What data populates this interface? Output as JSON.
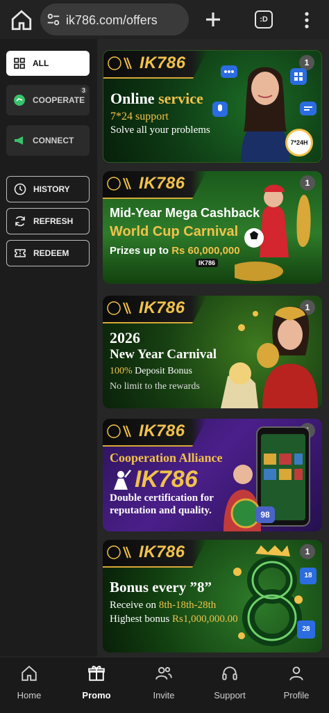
{
  "browser": {
    "url": "ik786.com/offers",
    "tabs_label": ":D"
  },
  "sidebar": {
    "all": "ALL",
    "cooperate": "COOPERATE",
    "cooperate_badge": "3",
    "connect": "CONNECT",
    "history": "HISTORY",
    "refresh": "REFRESH",
    "redeem": "REDEEM"
  },
  "brand": "IK786",
  "banners": [
    {
      "count": "1",
      "title_white": "Online ",
      "title_gold": "service",
      "line1": "7*24 support",
      "line2": "Solve all your problems",
      "badge": "7*24H"
    },
    {
      "count": "1",
      "line1": "Mid-Year Mega Cashback",
      "line2": "World Cup Carnival",
      "line3_a": "Prizes up to ",
      "line3_b": "Rs 60,000,000",
      "player_tag": "IK786"
    },
    {
      "count": "1",
      "line1": "2026",
      "line2": "New Year Carnival",
      "line3_a": "100%",
      "line3_b": " Deposit Bonus",
      "line4": "No limit to the rewards"
    },
    {
      "count": "1",
      "line1": "Cooperation Alliance",
      "line2": "IK786",
      "line3": "Double certification for",
      "line4": "reputation and quality.",
      "chip": "98"
    },
    {
      "count": "1",
      "line1": "Bonus every ”8”",
      "line2_a": "Receive on ",
      "line2_b": "8th-18th-28th",
      "line3_a": "Highest bonus ",
      "line3_b": "Rs1,000,000.00",
      "cal1": "18",
      "cal2": "28"
    }
  ],
  "bottom_nav": [
    {
      "label": "Home",
      "icon": "home-icon"
    },
    {
      "label": "Promo",
      "icon": "gift-icon"
    },
    {
      "label": "Invite",
      "icon": "invite-icon"
    },
    {
      "label": "Support",
      "icon": "headset-icon"
    },
    {
      "label": "Profile",
      "icon": "profile-icon"
    }
  ],
  "colors": {
    "accent_gold": "#f1c24b",
    "sidebar_bg": "#1c1c1c",
    "active_pill": "#ffffff"
  }
}
